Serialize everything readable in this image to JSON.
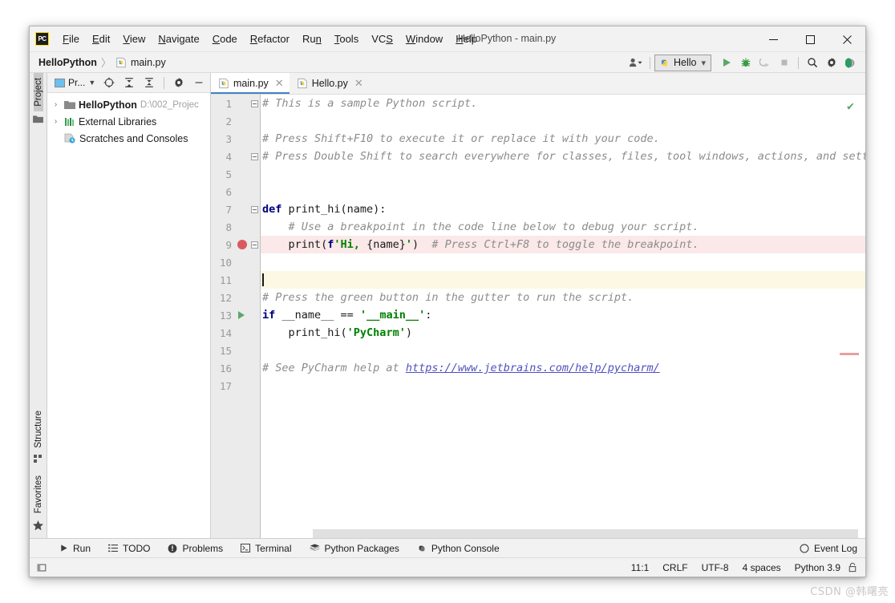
{
  "window": {
    "title": "HelloPython - main.py",
    "logo_text": "PC",
    "minimize": "−",
    "maximize": "□",
    "close": "✕"
  },
  "menubar": {
    "items": [
      {
        "label": "File",
        "mnemonic": "F",
        "rest": "ile"
      },
      {
        "label": "Edit",
        "mnemonic": "E",
        "rest": "dit"
      },
      {
        "label": "View",
        "mnemonic": "V",
        "rest": "iew"
      },
      {
        "label": "Navigate",
        "mnemonic": "N",
        "rest": "avigate"
      },
      {
        "label": "Code",
        "mnemonic": "C",
        "rest": "ode"
      },
      {
        "label": "Refactor",
        "mnemonic": "R",
        "rest": "efactor"
      },
      {
        "label": "Run",
        "mnemonic": "R",
        "rest": "un"
      },
      {
        "label": "Tools",
        "mnemonic": "T",
        "rest": "ools"
      },
      {
        "label": "VCS",
        "mnemonic": "S",
        "rest": "VCS"
      },
      {
        "label": "Window",
        "mnemonic": "W",
        "rest": "indow"
      },
      {
        "label": "Help",
        "mnemonic": "H",
        "rest": "elp"
      }
    ]
  },
  "navbar": {
    "project_crumb": "HelloPython",
    "separator": "〉",
    "file_crumb": "main.py",
    "run_config": "Hello",
    "run_config_chevron": "⌄"
  },
  "sidebar_strip": {
    "project_tab": "Project",
    "structure_tab": "Structure",
    "favorites_tab": "Favorites"
  },
  "project_panel": {
    "title": "Pr...",
    "tree": [
      {
        "label": "HelloPython",
        "path": "D:\\002_Projec",
        "arrow": "›",
        "bold": true,
        "icon": "folder-icon"
      },
      {
        "label": "External Libraries",
        "path": "",
        "arrow": "›",
        "bold": false,
        "icon": "libraries-icon"
      },
      {
        "label": "Scratches and Consoles",
        "path": "",
        "arrow": "",
        "bold": false,
        "icon": "scratches-icon"
      }
    ]
  },
  "editor": {
    "tabs": [
      {
        "label": "main.py",
        "active": true,
        "close": "✕"
      },
      {
        "label": "Hello.py",
        "active": false,
        "close": "✕"
      }
    ],
    "inspection_ok": "✔",
    "lines": [
      {
        "n": "1",
        "fold": "collapse",
        "bp": false,
        "run": false,
        "hl": "none",
        "tokens": [
          {
            "t": "# This is a sample Python script.",
            "c": "c-comment"
          }
        ]
      },
      {
        "n": "2",
        "fold": "none",
        "bp": false,
        "run": false,
        "hl": "none",
        "tokens": []
      },
      {
        "n": "3",
        "fold": "none",
        "bp": false,
        "run": false,
        "hl": "none",
        "tokens": [
          {
            "t": "# Press Shift+F10 to execute it or replace it with your code.",
            "c": "c-comment"
          }
        ]
      },
      {
        "n": "4",
        "fold": "collapse",
        "bp": false,
        "run": false,
        "hl": "none",
        "tokens": [
          {
            "t": "# Press Double Shift to search everywhere for classes, files, tool windows, actions, and setti",
            "c": "c-comment"
          }
        ]
      },
      {
        "n": "5",
        "fold": "none",
        "bp": false,
        "run": false,
        "hl": "none",
        "tokens": []
      },
      {
        "n": "6",
        "fold": "none",
        "bp": false,
        "run": false,
        "hl": "none",
        "tokens": []
      },
      {
        "n": "7",
        "fold": "collapse",
        "bp": false,
        "run": false,
        "hl": "none",
        "tokens": [
          {
            "t": "def ",
            "c": "c-kw"
          },
          {
            "t": "print_hi(name):",
            "c": "c-plain"
          }
        ]
      },
      {
        "n": "8",
        "fold": "none",
        "bp": false,
        "run": false,
        "hl": "none",
        "tokens": [
          {
            "t": "    # Use a breakpoint in the code line below to debug your script.",
            "c": "c-comment"
          }
        ]
      },
      {
        "n": "9",
        "fold": "collapse2",
        "bp": true,
        "run": false,
        "hl": "bp",
        "tokens": [
          {
            "t": "    print(",
            "c": "c-plain"
          },
          {
            "t": "f",
            "c": "c-fprefix"
          },
          {
            "t": "'Hi, ",
            "c": "c-str"
          },
          {
            "t": "{name}",
            "c": "c-plain"
          },
          {
            "t": "'",
            "c": "c-str"
          },
          {
            "t": ")  ",
            "c": "c-plain"
          },
          {
            "t": "# Press Ctrl+F8 to toggle the breakpoint.",
            "c": "c-comment"
          }
        ]
      },
      {
        "n": "10",
        "fold": "none",
        "bp": false,
        "run": false,
        "hl": "none",
        "tokens": []
      },
      {
        "n": "11",
        "fold": "none",
        "bp": false,
        "run": false,
        "hl": "caret",
        "caret": true,
        "tokens": []
      },
      {
        "n": "12",
        "fold": "none",
        "bp": false,
        "run": false,
        "hl": "none",
        "tokens": [
          {
            "t": "# Press the green button in the gutter to run the script.",
            "c": "c-comment"
          }
        ]
      },
      {
        "n": "13",
        "fold": "none",
        "bp": false,
        "run": true,
        "hl": "none",
        "tokens": [
          {
            "t": "if ",
            "c": "c-kw"
          },
          {
            "t": "__name__ == ",
            "c": "c-plain"
          },
          {
            "t": "'__main__'",
            "c": "c-str"
          },
          {
            "t": ":",
            "c": "c-plain"
          }
        ]
      },
      {
        "n": "14",
        "fold": "none",
        "bp": false,
        "run": false,
        "hl": "none",
        "tokens": [
          {
            "t": "    print_hi(",
            "c": "c-plain"
          },
          {
            "t": "'PyCharm'",
            "c": "c-str"
          },
          {
            "t": ")",
            "c": "c-plain"
          }
        ]
      },
      {
        "n": "15",
        "fold": "none",
        "bp": false,
        "run": false,
        "hl": "none",
        "tokens": []
      },
      {
        "n": "16",
        "fold": "none",
        "bp": false,
        "run": false,
        "hl": "none",
        "tokens": [
          {
            "t": "# See PyCharm help at ",
            "c": "c-comment"
          },
          {
            "t": "https://www.jetbrains.com/help/pycharm/",
            "c": "c-link"
          }
        ]
      },
      {
        "n": "17",
        "fold": "none",
        "bp": false,
        "run": false,
        "hl": "none",
        "tokens": []
      }
    ]
  },
  "tool_windows": [
    {
      "label": "Run",
      "icon": "run-icon"
    },
    {
      "label": "TODO",
      "icon": "todo-icon"
    },
    {
      "label": "Problems",
      "icon": "problems-icon"
    },
    {
      "label": "Terminal",
      "icon": "terminal-icon"
    },
    {
      "label": "Python Packages",
      "icon": "packages-icon"
    },
    {
      "label": "Python Console",
      "icon": "python-console-icon"
    }
  ],
  "event_log": {
    "label": "Event Log",
    "icon": "event-log-icon"
  },
  "statusbar": {
    "caret_position": "11:1",
    "line_separator": "CRLF",
    "encoding": "UTF-8",
    "indent": "4 spaces",
    "interpreter": "Python 3.9",
    "lock_icon": "🔒"
  },
  "watermark": "CSDN @韩曙亮",
  "colors": {
    "accent_blue": "#4083c9",
    "run_green": "#59a869",
    "breakpoint_red": "#db5860",
    "string_green": "#008000",
    "keyword_navy": "#000080",
    "comment_gray": "#8c8c8c",
    "caret_line": "#fdf8e3",
    "breakpoint_line": "#fbe8e8"
  }
}
